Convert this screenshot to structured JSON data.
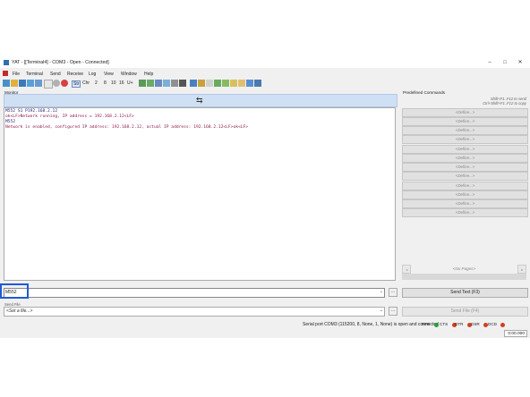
{
  "window": {
    "title": "YAT - [[Terminal4] - COM3 - Open - Connected]",
    "minimize": "–",
    "maximize": "□",
    "close": "✕"
  },
  "menu": [
    "File",
    "Terminal",
    "Send",
    "Receive",
    "Log",
    "View",
    "Window",
    "Help"
  ],
  "toolbar": {
    "str": "Str",
    "chr": "Chr",
    "radix": [
      "2",
      "8",
      "10",
      "16",
      "U+"
    ]
  },
  "monitor": {
    "label": "Monitor",
    "lines": [
      {
        "text": "M552 S1 P192.168.2.12",
        "color": "#1a1a6e"
      },
      {
        "text": "ok<LF>Network running, IP address = 192.168.2.12<LF>",
        "color": "#8b1a4a"
      },
      {
        "text": "M552",
        "color": "#1a1a6e"
      },
      {
        "text": "Network is enabled, configured IP address: 192.168.2.12, actual IP address: 192.168.2.12<LF>ok<LF>",
        "color": "#8b1a4a"
      }
    ]
  },
  "send_text": {
    "value": "M552",
    "button": "Send Text (F3)"
  },
  "send_file": {
    "label": "Send File",
    "value": "<Set a file...>",
    "button": "Send File (F4)"
  },
  "predefined": {
    "label": "Predefined Commands",
    "hint1": "Shift+F1..F12 to send",
    "hint2": "Ctrl+Shift+F1..F12 to copy",
    "define_label": "<Define...>",
    "pages": "<No Pages>"
  },
  "status": {
    "text": "Serial port COM3 (115200, 8, None, 1, None) is open and connected",
    "signals": [
      {
        "name": "RFR",
        "color": "#2e9e3a"
      },
      {
        "name": "CTS",
        "color": "#d04020"
      },
      {
        "name": "DTR",
        "color": "#d04020"
      },
      {
        "name": "DSR",
        "color": "#d04020"
      },
      {
        "name": "DCD",
        "color": "#d04020"
      }
    ],
    "timer": "0:00.000"
  },
  "colors": {
    "accent_highlight": "#1f5ad6",
    "swap_bar": "#cfe0f5"
  }
}
